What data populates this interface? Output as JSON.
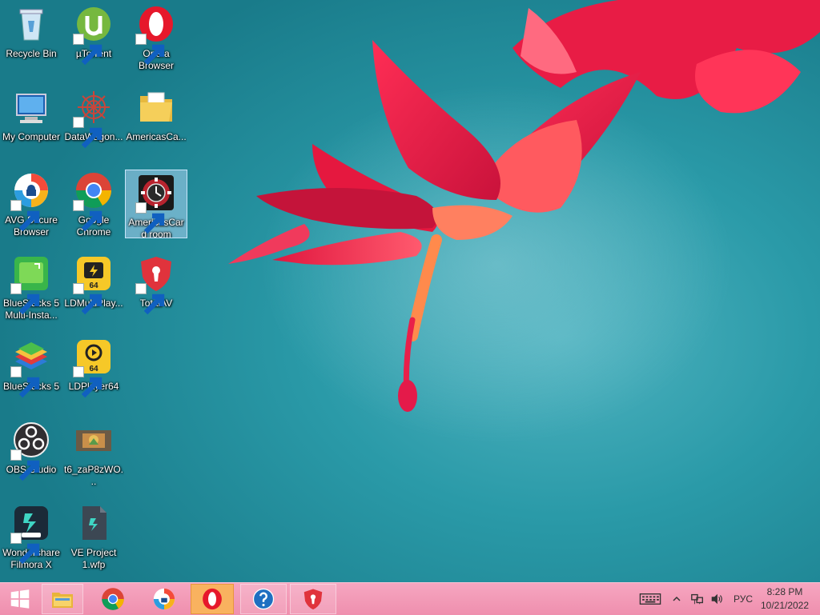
{
  "desktop": {
    "icons": [
      {
        "label": "Recycle Bin"
      },
      {
        "label": "µTorrent"
      },
      {
        "label": "Opera Browser"
      },
      {
        "label": "My Computer"
      },
      {
        "label": "DataWagon..."
      },
      {
        "label": "AmericasCa..."
      },
      {
        "label": "AVG Secure Browser"
      },
      {
        "label": "Google Chrome"
      },
      {
        "label": "AmericasCard room"
      },
      {
        "label": "BlueStacks 5 Multi-Insta..."
      },
      {
        "label": "LDMultiPlay..."
      },
      {
        "label": "TotalAV"
      },
      {
        "label": "BlueStacks 5"
      },
      {
        "label": "LDPlayer64"
      },
      {
        "label": "OBS Studio"
      },
      {
        "label": "t6_zaP8zWO..."
      },
      {
        "label": "Wondershare Filmora X"
      },
      {
        "label": "VE Project 1.wfp"
      }
    ],
    "badge_64": "64"
  },
  "taskbar": {
    "items": [
      {
        "icon": "windows-start-icon"
      },
      {
        "icon": "file-explorer-icon"
      },
      {
        "icon": "chrome-icon"
      },
      {
        "icon": "avg-browser-icon"
      },
      {
        "icon": "opera-icon"
      },
      {
        "icon": "help-icon"
      },
      {
        "icon": "totalav-icon"
      }
    ],
    "tray": {
      "language": "РУС",
      "time": "8:28 PM",
      "date": "10/21/2022"
    }
  },
  "colors": {
    "taskbar": "#ef8fae",
    "selection": "#aad2f0",
    "wallpaper": "#2a9aa8"
  }
}
